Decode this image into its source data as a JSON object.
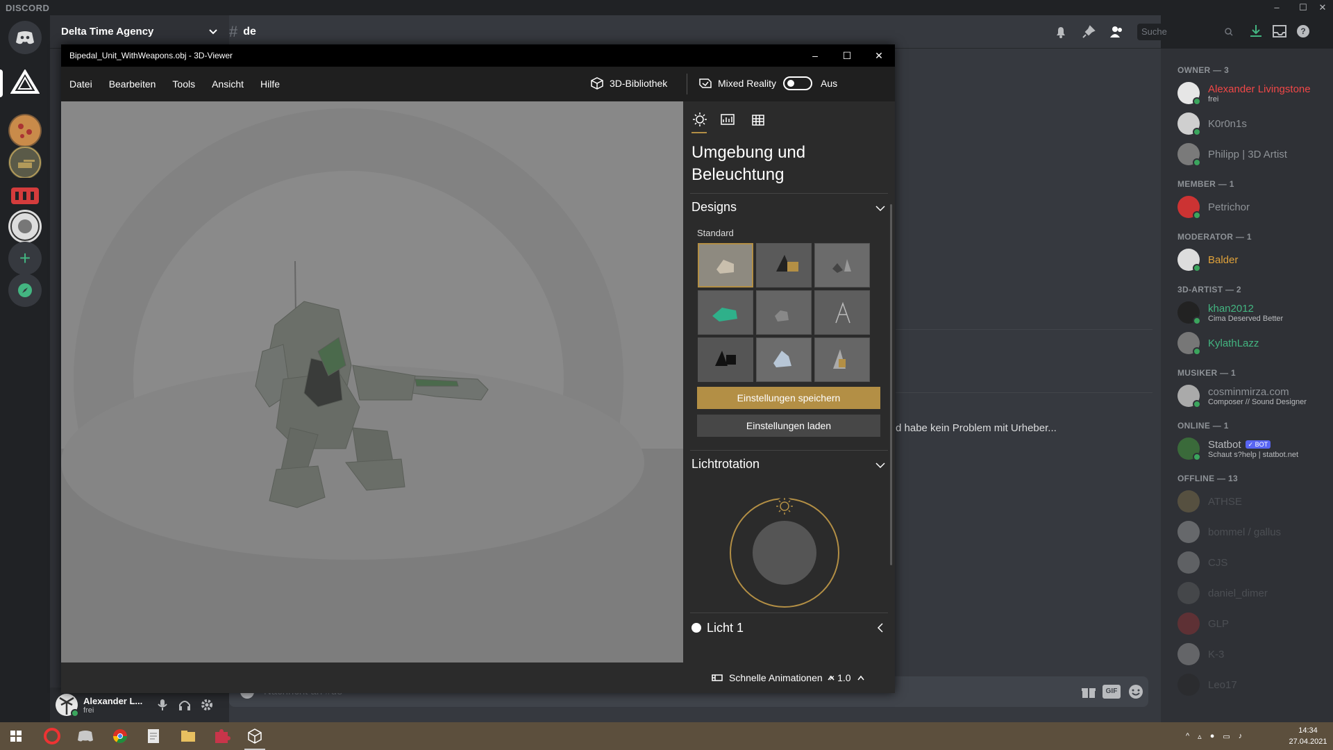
{
  "discord": {
    "logo": "DISCORD",
    "server_name": "Delta Time Agency",
    "channel_name": "de",
    "search_placeholder": "Suche",
    "chat_snippet": "d habe kein Problem mit Urheber...",
    "input_placeholder": "Nachricht an #de",
    "user": {
      "name": "Alexander L...",
      "status": "frei"
    },
    "members": {
      "groups": [
        {
          "header": "OWNER — 3",
          "items": [
            {
              "name": "Alexander Livingstone",
              "sub": "frei",
              "color": "#f04747"
            },
            {
              "name": "K0r0n1s",
              "sub": "",
              "color": "#8e9297"
            },
            {
              "name": "Philipp | 3D Artist",
              "sub": "",
              "color": "#8e9297"
            }
          ]
        },
        {
          "header": "MEMBER — 1",
          "items": [
            {
              "name": "Petrichor",
              "sub": "",
              "color": "#8e9297"
            }
          ]
        },
        {
          "header": "MODERATOR — 1",
          "items": [
            {
              "name": "Balder",
              "sub": "",
              "color": "#e0a23a"
            }
          ]
        },
        {
          "header": "3D-ARTIST — 2",
          "items": [
            {
              "name": "khan2012",
              "sub": "Cima Deserved Better",
              "color": "#43b581"
            },
            {
              "name": "KylathLazz",
              "sub": "",
              "color": "#43b581"
            }
          ]
        },
        {
          "header": "MUSIKER — 1",
          "items": [
            {
              "name": "cosminmirza.com",
              "sub": "Composer // Sound Designer",
              "color": "#8e9297"
            }
          ]
        },
        {
          "header": "ONLINE — 1",
          "items": [
            {
              "name": "Statbot",
              "sub": "Schaut s?help | statbot.net",
              "color": "#b9bbbe",
              "badge": "✓ BOT"
            }
          ]
        },
        {
          "header": "OFFLINE — 13",
          "items": [
            {
              "name": "ATHSE",
              "sub": "",
              "color": "#8e9297"
            },
            {
              "name": "bommel / gallus",
              "sub": "",
              "color": "#8e9297"
            },
            {
              "name": "CJS",
              "sub": "",
              "color": "#8e9297"
            },
            {
              "name": "daniel_dimer",
              "sub": "",
              "color": "#8e9297"
            },
            {
              "name": "GLP",
              "sub": "",
              "color": "#8e9297"
            },
            {
              "name": "K-3",
              "sub": "",
              "color": "#8e9297"
            },
            {
              "name": "Leo17",
              "sub": "",
              "color": "#8e9297"
            }
          ]
        }
      ]
    }
  },
  "viewer": {
    "title": "Bipedal_Unit_WithWeapons.obj - 3D-Viewer",
    "menu": [
      "Datei",
      "Bearbeiten",
      "Tools",
      "Ansicht",
      "Hilfe"
    ],
    "library_label": "3D-Bibliothek",
    "mixed_reality_label": "Mixed Reality",
    "mixed_reality_state": "Aus",
    "panel": {
      "heading_line1": "Umgebung und",
      "heading_line2": "Beleuchtung",
      "designs_label": "Designs",
      "standard_label": "Standard",
      "save_button": "Einstellungen speichern",
      "load_button": "Einstellungen laden",
      "rotation_label": "Lichtrotation",
      "light_label": "Licht 1"
    },
    "animations_label": "Schnelle Animationen",
    "speed_label": "× 1.0",
    "accent": "#b38f45"
  },
  "taskbar": {
    "time": "14:34",
    "date": "27.04.2021"
  }
}
